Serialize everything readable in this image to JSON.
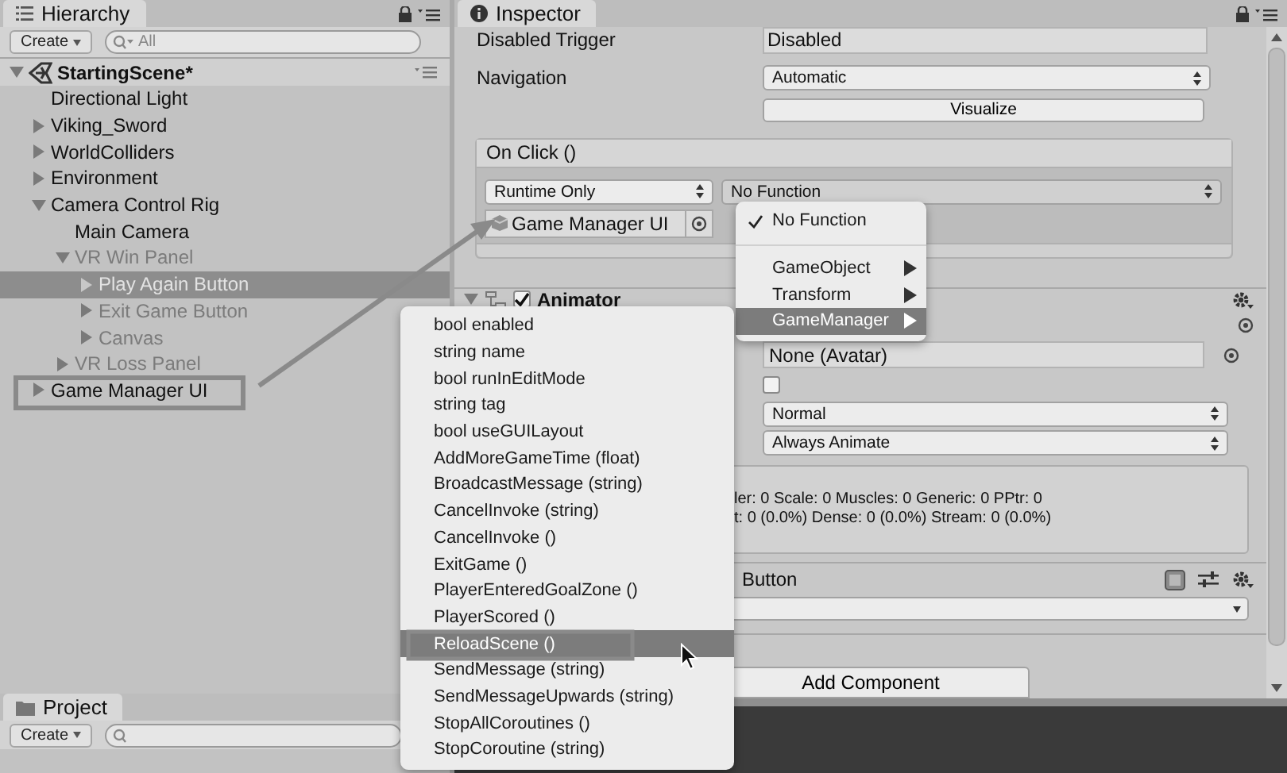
{
  "hierarchy": {
    "tab": "Hierarchy",
    "create_button": "Create",
    "search_placeholder": "All",
    "scene": {
      "name": "StartingScene*",
      "expanded": true
    },
    "items": [
      {
        "name": "Directional Light",
        "selected": false,
        "inactive": false
      },
      {
        "name": "Viking_Sword",
        "expanded": false,
        "selected": false,
        "inactive": false
      },
      {
        "name": "WorldColliders",
        "expanded": false,
        "selected": false,
        "inactive": false
      },
      {
        "name": "Environment",
        "expanded": false,
        "selected": false,
        "inactive": false
      },
      {
        "name": "Camera Control Rig",
        "expanded": true,
        "selected": false,
        "inactive": false,
        "children": [
          {
            "name": "Main Camera",
            "selected": false,
            "inactive": false
          },
          {
            "name": "VR Win Panel",
            "expanded": true,
            "selected": false,
            "inactive": true,
            "children": [
              {
                "name": "Play Again Button",
                "expanded": false,
                "selected": true,
                "inactive": true
              },
              {
                "name": "Exit Game Button",
                "expanded": false,
                "selected": false,
                "inactive": true
              },
              {
                "name": "Canvas",
                "expanded": false,
                "selected": false,
                "inactive": true
              }
            ]
          },
          {
            "name": "VR Loss Panel",
            "expanded": false,
            "selected": false,
            "inactive": true
          }
        ]
      },
      {
        "name": "Game Manager UI",
        "expanded": false,
        "selected": false,
        "inactive": false
      }
    ]
  },
  "project": {
    "tab": "Project",
    "create_button": "Create"
  },
  "inspector": {
    "tab": "Inspector",
    "button_props": [
      {
        "kind": "field",
        "label": "Disabled Trigger",
        "value": "Disabled"
      },
      {
        "kind": "dropdown",
        "label": "Navigation",
        "value": "Automatic"
      },
      {
        "kind": "button",
        "value": "Visualize"
      }
    ],
    "on_click": {
      "title": "On Click ()",
      "runtime": "Runtime Only",
      "function": "No Function",
      "target": "Game Manager UI"
    },
    "animator": {
      "name": "Animator",
      "enabled": true,
      "rows": [
        {
          "kind": "picker"
        },
        {
          "kind": "object",
          "value": "None (Avatar)"
        },
        {
          "kind": "checkbox",
          "checked": false
        },
        {
          "kind": "dropdown",
          "value": "Normal"
        },
        {
          "kind": "dropdown",
          "value": "Always Animate"
        }
      ],
      "info": [
        "ler: 0 Scale: 0 Muscles: 0 Generic: 0 PPtr: 0",
        "t: 0 (0.0%) Dense: 0 (0.0%) Stream: 0 (0.0%)"
      ]
    },
    "button_component": {
      "name": "Button"
    },
    "add_component": "Add Component"
  },
  "function_menu": {
    "items": [
      {
        "kind": "item",
        "label": "No Function",
        "checked": true,
        "selected": false
      },
      {
        "kind": "separator"
      },
      {
        "kind": "submenu",
        "label": "GameObject",
        "checked": false,
        "selected": false
      },
      {
        "kind": "submenu",
        "label": "Transform",
        "checked": false,
        "selected": false
      },
      {
        "kind": "submenu",
        "label": "GameManager",
        "checked": false,
        "selected": true
      }
    ]
  },
  "method_menu": {
    "items": [
      {
        "label": "bool enabled",
        "selected": false
      },
      {
        "label": "string name",
        "selected": false
      },
      {
        "label": "bool runInEditMode",
        "selected": false
      },
      {
        "label": "string tag",
        "selected": false
      },
      {
        "label": "bool useGUILayout",
        "selected": false
      },
      {
        "label": "AddMoreGameTime (float)",
        "selected": false
      },
      {
        "label": "BroadcastMessage (string)",
        "selected": false
      },
      {
        "label": "CancelInvoke (string)",
        "selected": false
      },
      {
        "label": "CancelInvoke ()",
        "selected": false
      },
      {
        "label": "ExitGame ()",
        "selected": false
      },
      {
        "label": "PlayerEnteredGoalZone ()",
        "selected": false
      },
      {
        "label": "PlayerScored ()",
        "selected": false
      },
      {
        "label": "ReloadScene ()",
        "selected": true
      },
      {
        "label": "SendMessage (string)",
        "selected": false
      },
      {
        "label": "SendMessageUpwards (string)",
        "selected": false
      },
      {
        "label": "StopAllCoroutines ()",
        "selected": false
      },
      {
        "label": "StopCoroutine (string)",
        "selected": false
      }
    ]
  }
}
